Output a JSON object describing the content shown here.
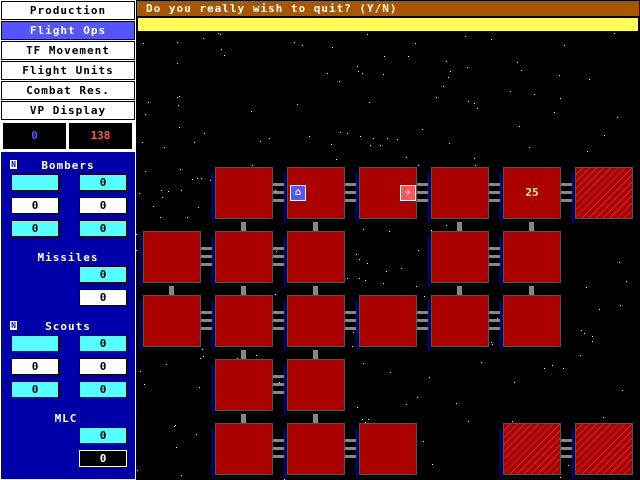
{
  "menu": [
    {
      "label": "Production"
    },
    {
      "label": "Flight Ops",
      "active": true
    },
    {
      "label": "TF Movement"
    },
    {
      "label": "Flight Units"
    },
    {
      "label": "Combat Res."
    },
    {
      "label": "VP Display"
    }
  ],
  "scores": {
    "left": "0",
    "right": "138",
    "left_color": "#5555ff",
    "right_color": "#ff5555"
  },
  "bombers": {
    "title": "Bombers",
    "values": [
      "",
      "0",
      "0",
      "0",
      "0",
      "0"
    ]
  },
  "missiles": {
    "title": "Missiles",
    "values": [
      "0",
      "0"
    ]
  },
  "scouts": {
    "title": "Scouts",
    "values": [
      "",
      "0",
      "0",
      "0",
      "0",
      "0"
    ]
  },
  "mlc": {
    "title": "MLC",
    "values": [
      "0",
      "0"
    ]
  },
  "prompt": {
    "message": "Do you really wish to quit? (Y/N)",
    "input": ""
  },
  "map": {
    "sector_label": "25",
    "icons": [
      "carrier-icon",
      "fighter-plane-icon"
    ]
  }
}
